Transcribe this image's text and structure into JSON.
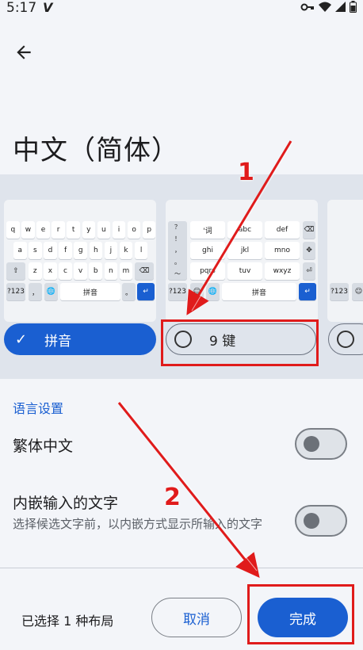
{
  "status_bar": {
    "time": "5:17",
    "icons": [
      "vpn-key-icon",
      "wifi-icon",
      "signal-icon",
      "battery-icon"
    ]
  },
  "header": {
    "back_icon": "arrow-left-icon",
    "title": "中文（简体）"
  },
  "layouts": {
    "qwerty_keyboard": {
      "row1": [
        "q",
        "w",
        "e",
        "r",
        "t",
        "y",
        "u",
        "i",
        "o",
        "p"
      ],
      "row2": [
        "a",
        "s",
        "d",
        "f",
        "g",
        "h",
        "j",
        "k",
        "l"
      ],
      "row3": [
        "z",
        "x",
        "c",
        "v",
        "b",
        "n",
        "m"
      ],
      "bottom": [
        "?123",
        "，",
        "拼音",
        "。"
      ]
    },
    "nine_key_keyboard": {
      "side": [
        "？",
        "！",
        "，",
        "。",
        "～"
      ],
      "row1": [
        "'词",
        "abc",
        "def"
      ],
      "row2": [
        "ghi",
        "jkl",
        "mno"
      ],
      "row3": [
        "pqrs",
        "tuv",
        "wxyz"
      ],
      "bottom": [
        "?123",
        "拼音"
      ]
    },
    "third_keyboard": {
      "bottom": [
        "?123"
      ]
    },
    "options": [
      {
        "label": "拼音",
        "selected": true
      },
      {
        "label": "9 键",
        "selected": false
      },
      {
        "label": "",
        "selected": false
      }
    ]
  },
  "settings": {
    "section_title": "语言设置",
    "items": [
      {
        "label": "繁体中文",
        "enabled": false
      },
      {
        "label": "内嵌输入的文字",
        "sublabel": "选择候选文字前，以内嵌方式显示所输入的文字",
        "enabled": false
      }
    ]
  },
  "footer": {
    "selected_count": "已选择 1 种布局",
    "cancel_label": "取消",
    "done_label": "完成"
  },
  "annotations": {
    "step1": "1",
    "step2": "2",
    "highlight_color": "#e01b1b"
  },
  "colors": {
    "accent": "#1a5fd1",
    "background": "#f3f5f9",
    "layout_band": "#dfe4ec"
  }
}
